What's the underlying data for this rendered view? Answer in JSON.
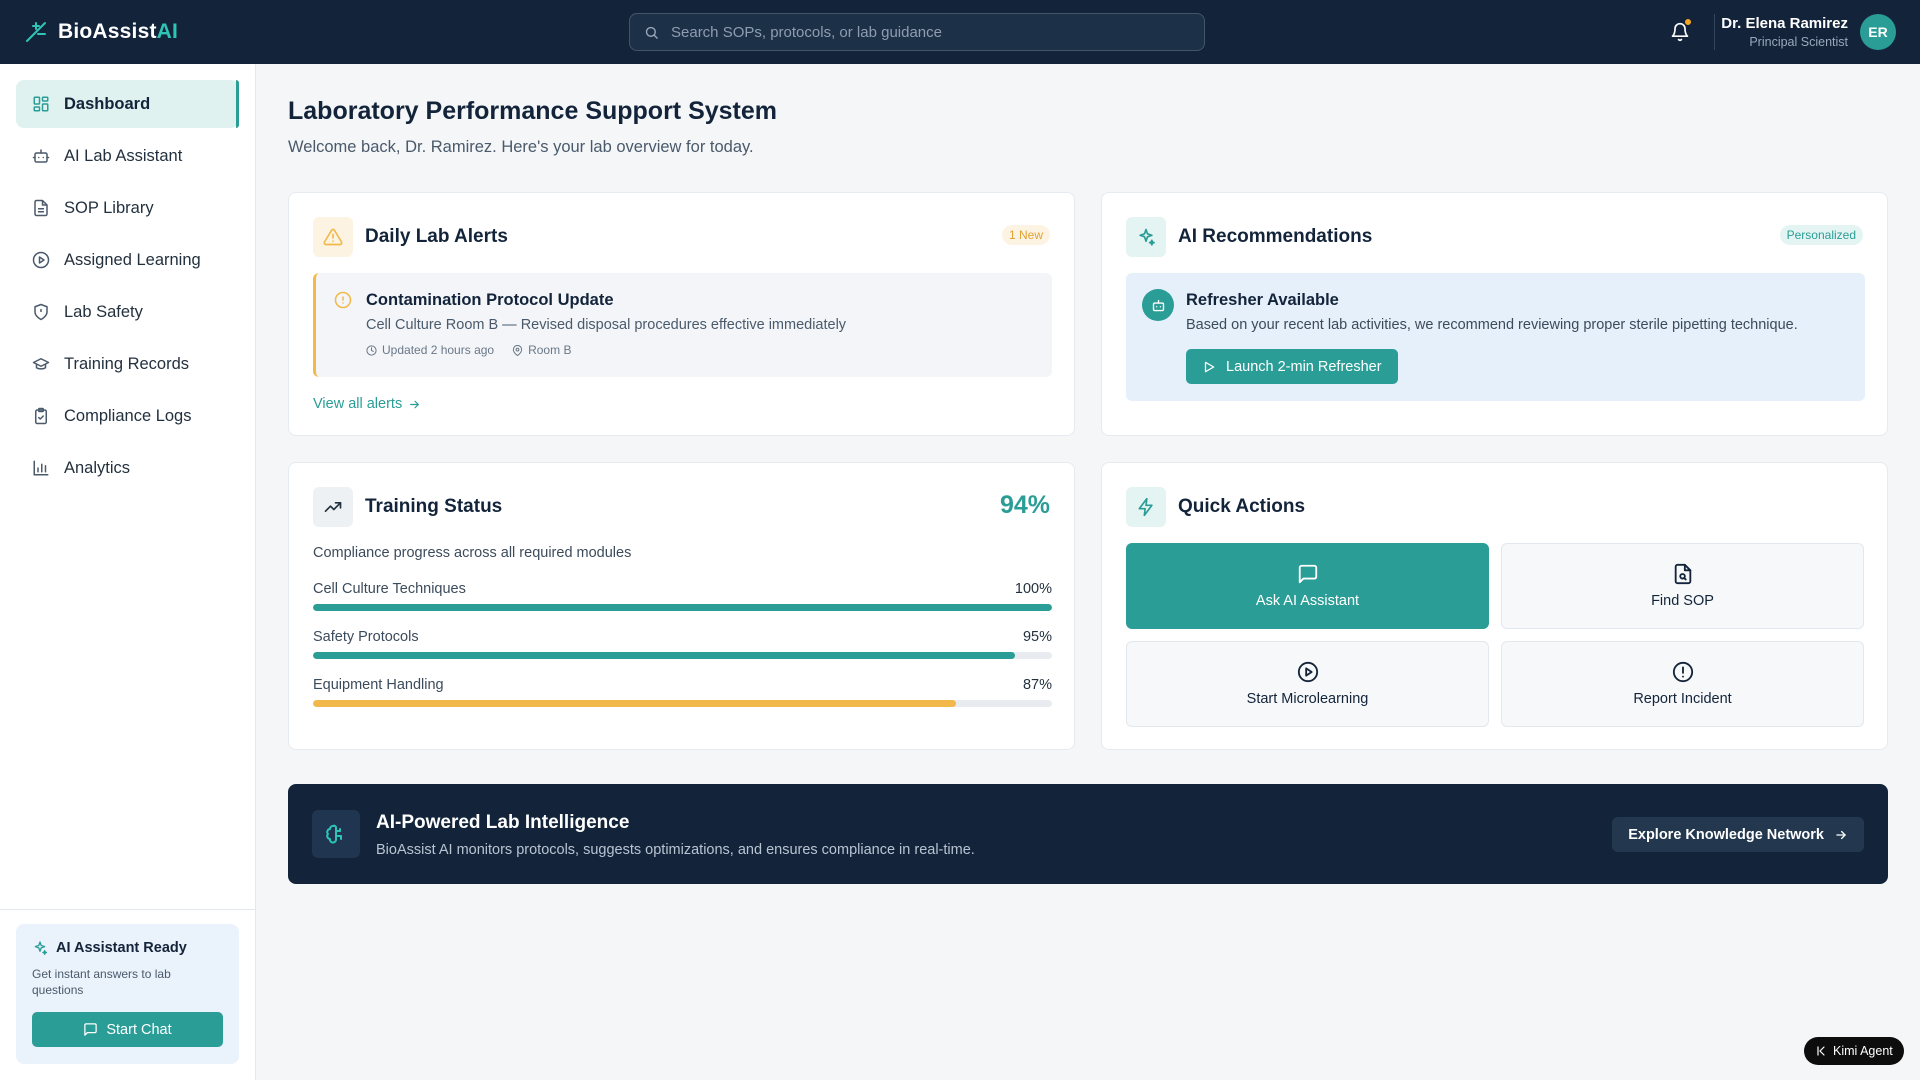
{
  "brand": {
    "name": "BioAssist",
    "suffix": "AI"
  },
  "search": {
    "placeholder": "Search SOPs, protocols, or lab guidance"
  },
  "user": {
    "name": "Dr. Elena Ramirez",
    "role": "Principal Scientist",
    "initials": "ER"
  },
  "sidebar": {
    "items": [
      {
        "label": "Dashboard",
        "icon": "grid-icon",
        "active": true
      },
      {
        "label": "AI Lab Assistant",
        "icon": "robot-icon"
      },
      {
        "label": "SOP Library",
        "icon": "document-icon"
      },
      {
        "label": "Assigned Learning",
        "icon": "play-circle-icon"
      },
      {
        "label": "Lab Safety",
        "icon": "shield-icon"
      },
      {
        "label": "Training Records",
        "icon": "graduation-cap-icon"
      },
      {
        "label": "Compliance Logs",
        "icon": "clipboard-check-icon"
      },
      {
        "label": "Analytics",
        "icon": "bar-chart-icon"
      }
    ],
    "assistant_card": {
      "title": "AI Assistant Ready",
      "desc": "Get instant answers to lab questions",
      "button": "Start Chat"
    }
  },
  "page": {
    "title": "Laboratory Performance Support System",
    "subtitle": "Welcome back, Dr. Ramirez. Here's your lab overview for today."
  },
  "alerts": {
    "title": "Daily Lab Alerts",
    "badge": "1 New",
    "item": {
      "title": "Contamination Protocol Update",
      "desc": "Cell Culture Room B — Revised disposal procedures effective immediately",
      "updated": "Updated 2 hours ago",
      "location": "Room B"
    },
    "link": "View all alerts"
  },
  "recommendations": {
    "title": "AI Recommendations",
    "badge": "Personalized",
    "item": {
      "title": "Refresher Available",
      "desc": "Based on your recent lab activities, we recommend reviewing proper sterile pipetting technique.",
      "button": "Launch 2-min Refresher"
    }
  },
  "training": {
    "title": "Training Status",
    "overall": "94%",
    "subtitle": "Compliance progress across all required modules",
    "modules": [
      {
        "name": "Cell Culture Techniques",
        "value": "100%",
        "fraction": 1.0,
        "color": "#2a9d96"
      },
      {
        "name": "Safety Protocols",
        "value": "95%",
        "fraction": 0.95,
        "color": "#2a9d96"
      },
      {
        "name": "Equipment Handling",
        "value": "87%",
        "fraction": 0.87,
        "color": "#f2b94a"
      }
    ]
  },
  "quick_actions": {
    "title": "Quick Actions",
    "items": [
      {
        "label": "Ask AI Assistant",
        "icon": "chat-icon"
      },
      {
        "label": "Find SOP",
        "icon": "file-search-icon"
      },
      {
        "label": "Start Microlearning",
        "icon": "play-circle-icon"
      },
      {
        "label": "Report Incident",
        "icon": "alert-circle-icon"
      }
    ]
  },
  "banner": {
    "title": "AI-Powered Lab Intelligence",
    "desc": "BioAssist AI monitors protocols, suggests optimizations, and ensures compliance in real-time.",
    "button": "Explore Knowledge Network"
  },
  "agent_badge": {
    "label": "Kimi Agent"
  },
  "colors": {
    "accent": "#2a9d96",
    "navy": "#13243a",
    "warning": "#f2b94a"
  }
}
